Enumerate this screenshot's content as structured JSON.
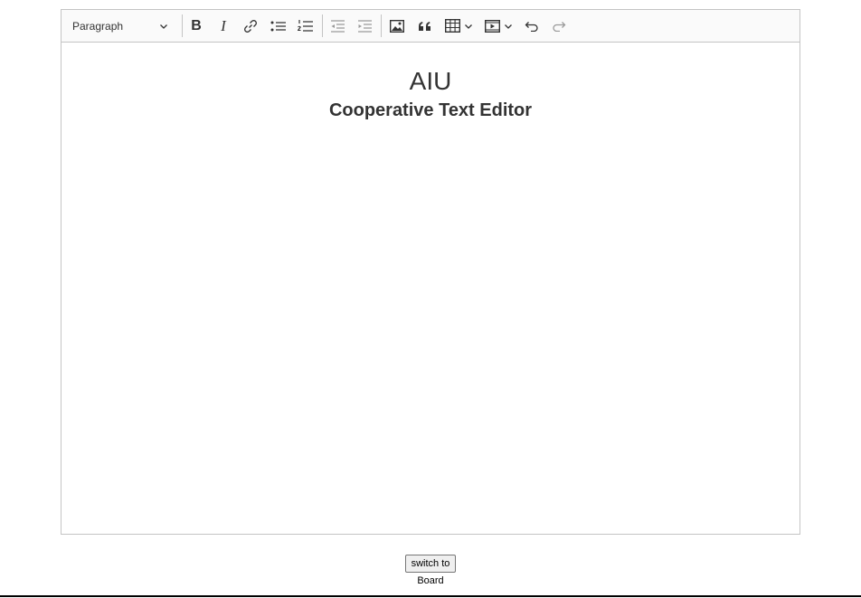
{
  "toolbar": {
    "paragraph_label": "Paragraph",
    "buttons": [
      "bold-icon",
      "italic-icon",
      "link-icon",
      "bulleted-list-icon",
      "numbered-list-icon",
      "outdent-icon",
      "indent-icon",
      "image-icon",
      "blockquote-icon",
      "table-icon",
      "media-icon",
      "undo-icon",
      "redo-icon"
    ]
  },
  "content": {
    "heading": "AIU",
    "subheading": "Cooperative Text Editor"
  },
  "footer": {
    "switch_label": "switch to",
    "switch_target": "Board"
  },
  "colors": {
    "border": "#c4c4c4",
    "toolbar_bg": "#fafafa",
    "text": "#333333",
    "disabled_icon": "#9a9a9a"
  }
}
